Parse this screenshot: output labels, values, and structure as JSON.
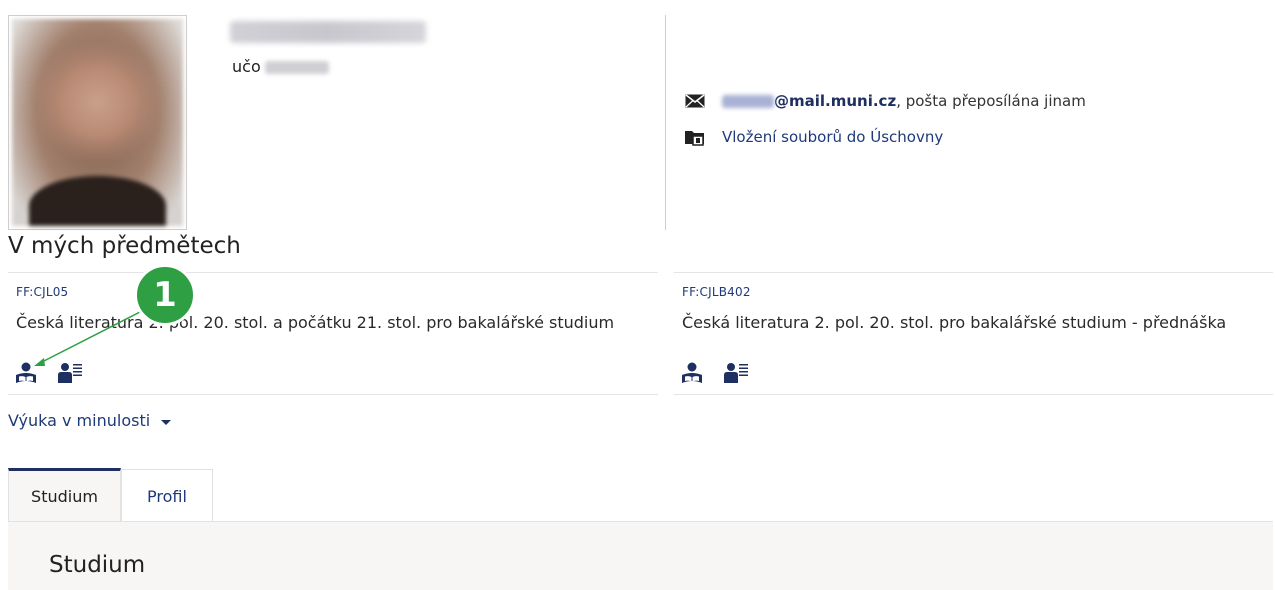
{
  "profile": {
    "uco_label": "učo"
  },
  "contact": {
    "email_domain": "@mail.muni.cz",
    "email_note": ", pošta přeposílána jinam",
    "upload_link": "Vložení souborů do Úschovny"
  },
  "section_title": "V mých předmětech",
  "courses": [
    {
      "code": "FF:CJL05",
      "title": "Česká literatura 2. pol. 20. stol. a počátku 21. stol. pro bakalářské studium"
    },
    {
      "code": "FF:CJLB402",
      "title": "Česká literatura 2. pol. 20. stol. pro bakalářské studium - přednáška"
    }
  ],
  "past_teaching": {
    "label": "Výuka v minulosti"
  },
  "tabs": [
    {
      "label": "Studium",
      "active": true
    },
    {
      "label": "Profil",
      "active": false
    }
  ],
  "panel": {
    "title": "Studium"
  },
  "annotation": {
    "badge_number": "1",
    "color": "#2ea043"
  },
  "colors": {
    "accent": "#1e2f61",
    "link": "#1e3a7a"
  },
  "icons": {
    "email": "envelope-icon",
    "upload": "folder-upload-icon",
    "course_student": "student-reading-icon",
    "course_list": "person-list-icon",
    "dropdown": "caret-down-icon"
  }
}
